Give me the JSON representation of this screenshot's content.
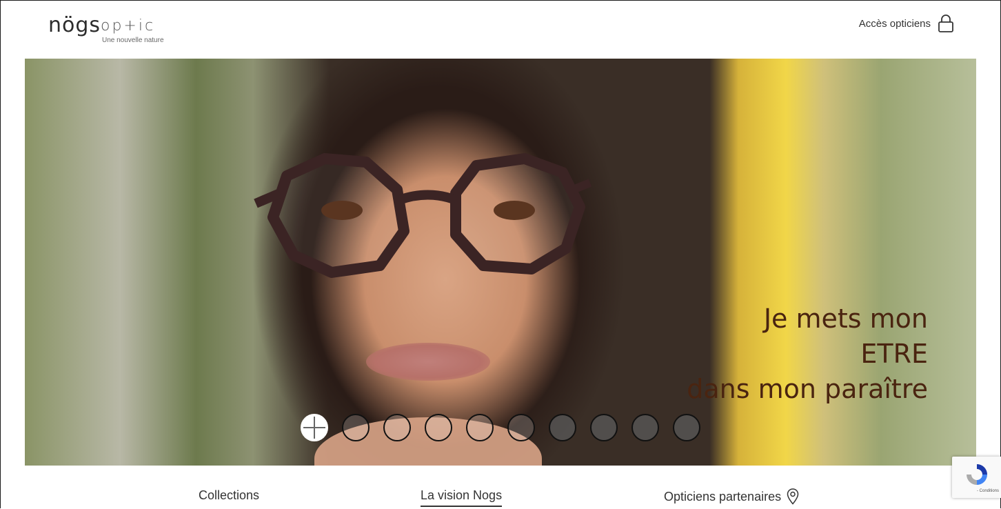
{
  "header": {
    "logo": {
      "brand": "nögs",
      "product": "op+ic",
      "tagline": "Une nouvelle nature"
    },
    "access_label": "Accès opticiens"
  },
  "hero": {
    "headline_lines": [
      "Je mets mon",
      "ETRE",
      "dans mon paraître"
    ],
    "carousel": {
      "total_slides": 10,
      "active_index": 0
    }
  },
  "nav": {
    "items": [
      {
        "label": "Collections",
        "active": false
      },
      {
        "label": "La vision Nogs",
        "active": true
      },
      {
        "label": "Opticiens partenaires",
        "active": false,
        "icon": "map-pin-icon"
      }
    ]
  },
  "recaptcha": {
    "links_text": "- Conditions"
  },
  "colors": {
    "headline": "#4a2410",
    "text": "#333333",
    "border": "#1a1a1a",
    "recaptcha_blue": "#1c3aa9"
  }
}
